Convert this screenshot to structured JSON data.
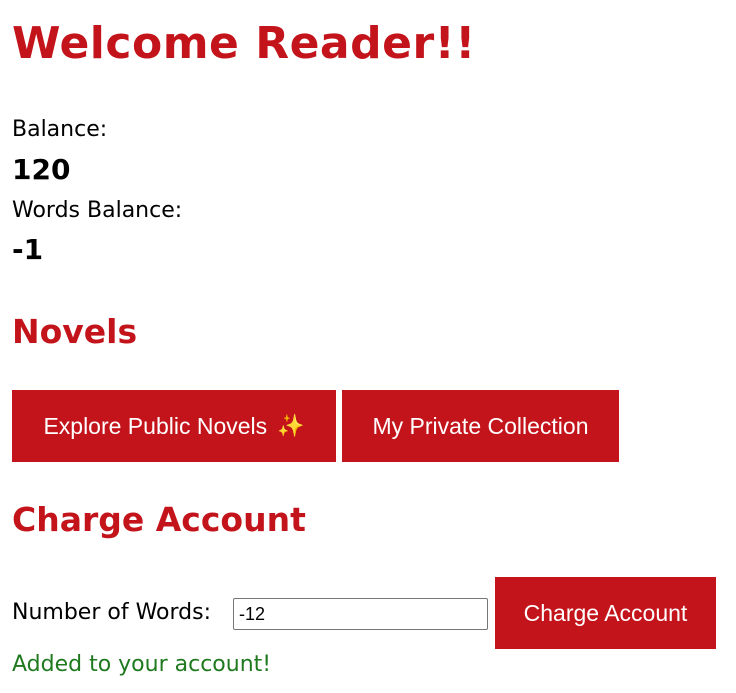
{
  "header": {
    "title": "Welcome Reader!!"
  },
  "account": {
    "balance_label": "Balance:",
    "balance_value": "120",
    "words_balance_label": "Words Balance:",
    "words_balance_value": "-1"
  },
  "novels": {
    "heading": "Novels",
    "explore_button": "Explore Public Novels",
    "explore_icon": "✨",
    "private_button": "My Private Collection"
  },
  "charge": {
    "heading": "Charge Account",
    "words_label": "Number of Words:",
    "words_value": "-12",
    "submit_button": "Charge Account",
    "success_message": "Added to your account!"
  },
  "colors": {
    "accent": "#c4141b",
    "success": "#1f7a1f"
  }
}
